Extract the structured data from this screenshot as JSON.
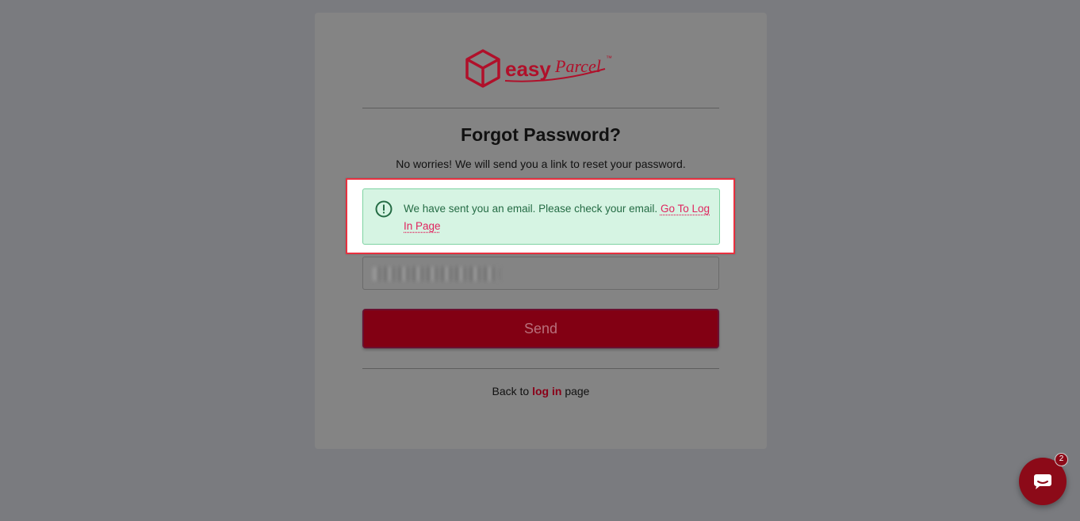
{
  "brand": {
    "logo_alt": "easyParcel",
    "easy": "easy",
    "parcel": "Parcel",
    "tm": "™",
    "color": "#c8102e"
  },
  "form": {
    "title": "Forgot Password?",
    "subtitle": "No worries! We will send you a link to reset your password.",
    "send_label": "Send"
  },
  "alert": {
    "message": "We have sent you an email. Please check your email.",
    "link_text": "Go To Log In Page",
    "icon": "exclamation-circle-icon"
  },
  "footer": {
    "prefix": "Back to",
    "link": "log in",
    "suffix": "page"
  },
  "chat": {
    "badge_count": "2",
    "icon": "chat-bubble-icon"
  }
}
